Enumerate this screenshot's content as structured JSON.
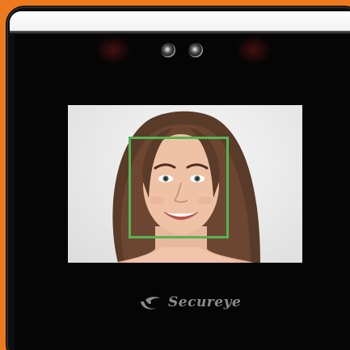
{
  "brand": {
    "name": "Secureye",
    "logo_icon": "swoosh-smile-logo"
  },
  "device": {
    "camera_icons": [
      "camera-lens-icon",
      "camera-lens-icon"
    ]
  },
  "detection": {
    "box_color": "#55b552",
    "subject_icon": "face-portrait"
  },
  "colors": {
    "background": "#ee7a1f",
    "device_body": "#0e0e0f",
    "bezel": "#ffffff"
  }
}
